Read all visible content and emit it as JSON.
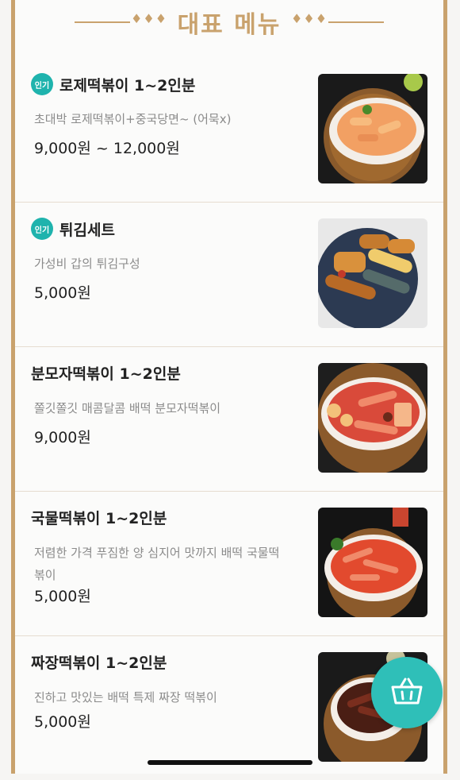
{
  "header": {
    "title": "대표 메뉴",
    "left_ornament": "♦♦♦",
    "right_ornament": "♦♦♦"
  },
  "menu": [
    {
      "badge": "인기",
      "name": "로제떡볶이 1~2인분",
      "description": "초대박 로제떡볶이+중국당면~ (어묵x)",
      "price": "9,000원 ~ 12,000원"
    },
    {
      "badge": "인기",
      "name": "튀김세트",
      "description": "가성비 갑의 튀김구성",
      "price": "5,000원"
    },
    {
      "badge": "",
      "name": "분모자떡볶이 1~2인분",
      "description": "쫄깃쫄깃 매콤달콤 배떡 분모자떡볶이",
      "price": "9,000원"
    },
    {
      "badge": "",
      "name": "국물떡볶이 1~2인분",
      "description": "저렴한 가격 푸짐한 양 심지어 맛까지 배떡 국물떡볶이",
      "price": "5,000원"
    },
    {
      "badge": "",
      "name": "짜장떡볶이 1~2인분",
      "description": "진하고 맛있는 배떡 특제 짜장 떡볶이",
      "price": "5,000원"
    }
  ],
  "colors": {
    "accent": "#c9a26d",
    "badge": "#1fb3ad",
    "cart": "#2fbfb8"
  },
  "icons": {
    "cart": "basket-icon"
  }
}
